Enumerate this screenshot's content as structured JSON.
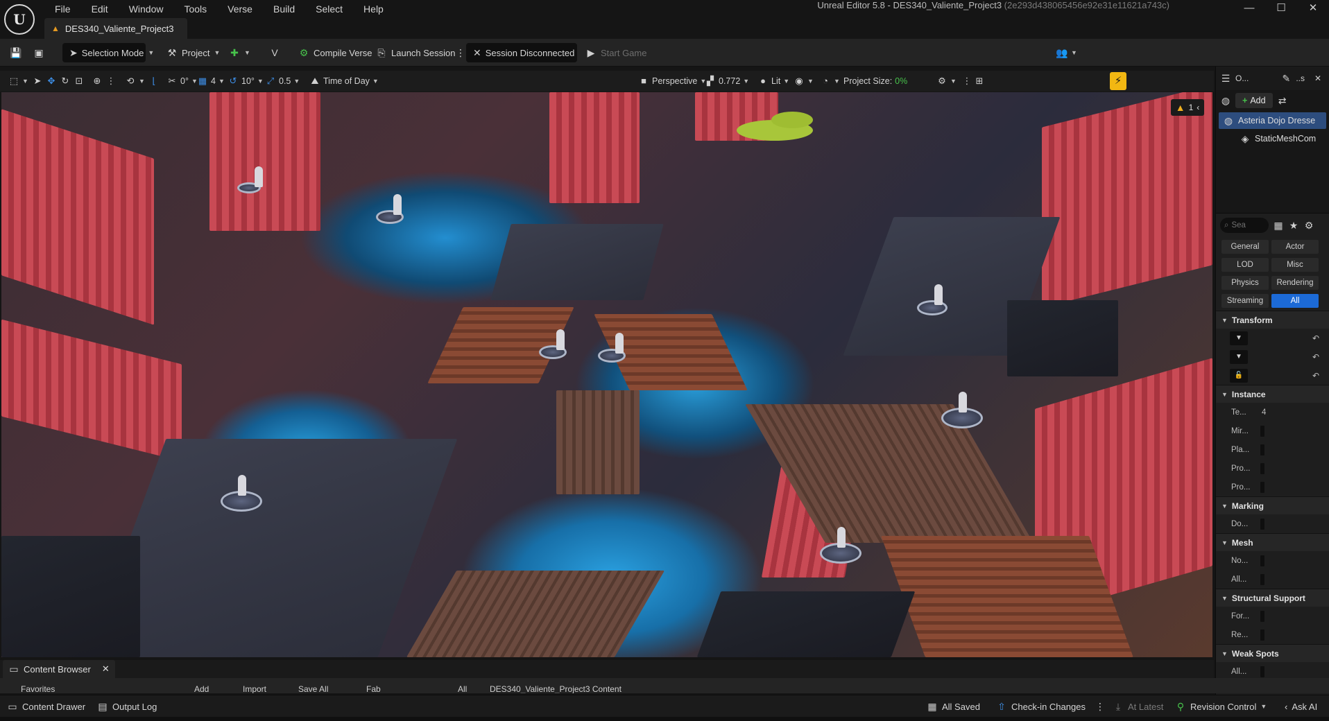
{
  "window": {
    "title": "Unreal Editor 5.8 - DES340_Valiente_Project3",
    "hash": "(2e293d438065456e92e31e11621a743c)",
    "controls": [
      "—",
      "☐",
      "✕"
    ]
  },
  "menu": [
    "File",
    "Edit",
    "Window",
    "Tools",
    "Verse",
    "Build",
    "Select",
    "Help"
  ],
  "doc_tab": {
    "label": "DES340_Valiente_Project3"
  },
  "toolbar": {
    "selection_mode": "Selection Mode",
    "project": "Project",
    "compile_verse": "Compile Verse",
    "launch_session": "Launch Session",
    "session_status": "Session Disconnected",
    "start_game": "Start Game"
  },
  "viewport_toolbar": {
    "rotation_snap": "0°",
    "grid_snap": "4",
    "angle_snap": "10°",
    "scale_snap": "0.5",
    "time_of_day": "Time of Day",
    "perspective": "Perspective",
    "camera_speed": "0.772",
    "view_mode": "Lit",
    "project_size_label": "Project Size:",
    "project_size_value": "0%"
  },
  "viewport": {
    "warning_count": "1"
  },
  "outliner": {
    "tab": "O...",
    "details_tab": "..s",
    "add_label": "Add",
    "rows": [
      {
        "label": "Asteria Dojo Dresse",
        "selected": true
      },
      {
        "label": "StaticMeshCom",
        "selected": false
      }
    ]
  },
  "details": {
    "search_placeholder": "Sea",
    "filters": [
      "General",
      "Actor",
      "LOD",
      "Misc",
      "Physics",
      "Rendering",
      "Streaming",
      "All"
    ],
    "categories": {
      "transform": "Transform",
      "instance": "Instance",
      "marking": "Marking",
      "mesh": "Mesh",
      "structural": "Structural Support",
      "weak_spots": "Weak Spots"
    },
    "instance_props": [
      "Te...",
      "Mir...",
      "Pla...",
      "Pro...",
      "Pro..."
    ],
    "marking_props": [
      "Do..."
    ],
    "mesh_props": [
      "No...",
      "All..."
    ],
    "structural_props": [
      "For...",
      "Re..."
    ],
    "weak_props": [
      "All..."
    ],
    "instance_first_value": "4"
  },
  "content_browser": {
    "tab": "Content Browser",
    "strip": [
      "Favorites",
      "Add",
      "Import",
      "Save All",
      "Fab",
      "All",
      "DES340_Valiente_Project3 Content"
    ]
  },
  "status_bar": {
    "content_drawer": "Content Drawer",
    "output_log": "Output Log",
    "all_saved": "All Saved",
    "check_in": "Check-in Changes",
    "at_latest": "At Latest",
    "revision_control": "Revision Control",
    "ask_ai": "Ask AI"
  }
}
